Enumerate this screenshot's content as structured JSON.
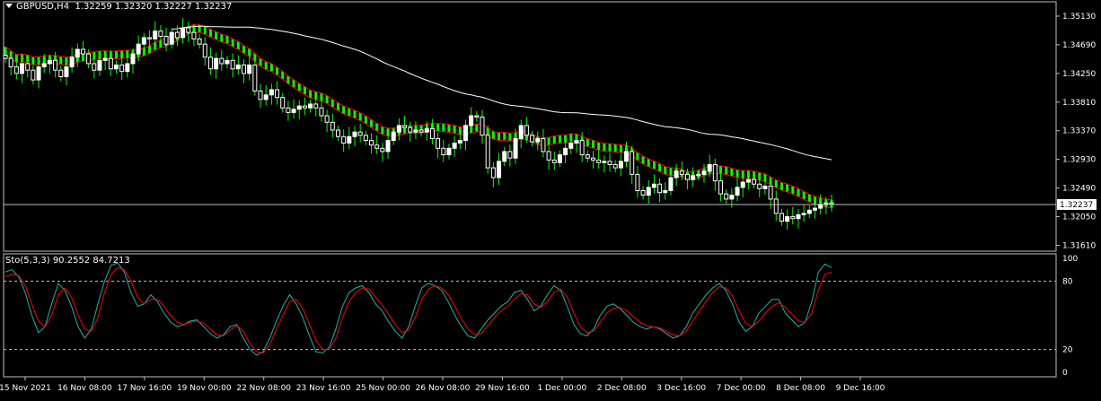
{
  "header": {
    "symbol": "GBPUSD,H4",
    "ohlc": "1.32259 1.32320 1.32227 1.32237"
  },
  "colors": {
    "background": "#000000",
    "frame": "#c0c0c0",
    "text": "#ffffff",
    "candle_bull": "#ffffff",
    "candle_bear": "#ffffff",
    "wick": "#00ff00",
    "band_fill": "#00ff00",
    "band_line": "#ff0000",
    "ma_slow": "#ffffff",
    "stoch_main": "#20b2aa",
    "stoch_signal": "#ff0000",
    "price_line": "#c0c0c0",
    "level_line": "#c0c0c0"
  },
  "chart_data": [
    {
      "type": "candlestick",
      "symbol": "GBPUSD",
      "timeframe": "H4",
      "ylim": [
        1.3152,
        1.3535
      ],
      "y_ticks": [
        "1.35130",
        "1.34690",
        "1.34250",
        "1.33810",
        "1.33370",
        "1.32930",
        "1.32490",
        "1.32050",
        "1.31610"
      ],
      "current_price": "1.32237",
      "x_tick_labels": [
        "15 Nov 2021",
        "16 Nov 08:00",
        "17 Nov 16:00",
        "19 Nov 00:00",
        "22 Nov 08:00",
        "23 Nov 16:00",
        "25 Nov 00:00",
        "26 Nov 08:00",
        "29 Nov 16:00",
        "1 Dec 00:00",
        "2 Dec 08:00",
        "3 Dec 16:00",
        "7 Dec 00:00",
        "8 Dec 08:00",
        "9 Dec 16:00"
      ],
      "candles_close": [
        1.3448,
        1.3435,
        1.3425,
        1.344,
        1.343,
        1.3415,
        1.3435,
        1.344,
        1.3445,
        1.343,
        1.342,
        1.3435,
        1.345,
        1.3462,
        1.3455,
        1.344,
        1.343,
        1.3445,
        1.3448,
        1.3432,
        1.3438,
        1.3428,
        1.344,
        1.3455,
        1.347,
        1.348,
        1.3478,
        1.349,
        1.3482,
        1.347,
        1.3488,
        1.348,
        1.3495,
        1.3488,
        1.3478,
        1.347,
        1.345,
        1.3432,
        1.3448,
        1.344,
        1.3445,
        1.3432,
        1.3438,
        1.3425,
        1.3438,
        1.3398,
        1.3385,
        1.3392,
        1.34,
        1.3388,
        1.3372,
        1.3365,
        1.337,
        1.3375,
        1.3372,
        1.3378,
        1.3372,
        1.336,
        1.335,
        1.3338,
        1.3328,
        1.3318,
        1.3328,
        1.3335,
        1.333,
        1.3322,
        1.3315,
        1.331,
        1.3305,
        1.3322,
        1.3335,
        1.3345,
        1.3342,
        1.3335,
        1.3338,
        1.3335,
        1.334,
        1.3325,
        1.331,
        1.33,
        1.331,
        1.3318,
        1.3322,
        1.3345,
        1.336,
        1.3358,
        1.333,
        1.328,
        1.3265,
        1.329,
        1.3305,
        1.3295,
        1.3325,
        1.3345,
        1.333,
        1.332,
        1.3325,
        1.3305,
        1.3292,
        1.3288,
        1.33,
        1.331,
        1.3318,
        1.3322,
        1.33,
        1.3295,
        1.3292,
        1.3288,
        1.329,
        1.3285,
        1.328,
        1.329,
        1.3305,
        1.327,
        1.3245,
        1.3238,
        1.325,
        1.3255,
        1.3242,
        1.3245,
        1.3265,
        1.3275,
        1.327,
        1.3262,
        1.3268,
        1.327,
        1.3275,
        1.3285,
        1.326,
        1.324,
        1.3232,
        1.3238,
        1.325,
        1.3258,
        1.3262,
        1.3255,
        1.3248,
        1.3252,
        1.3232,
        1.321,
        1.3198,
        1.3205,
        1.3202,
        1.3208,
        1.321,
        1.3215,
        1.3218,
        1.3224,
        1.3226,
        1.3224
      ]
    },
    {
      "type": "line",
      "title": "Sto(5,3,3) 90.2552 84.7213",
      "indicator": "Stochastic Oscillator",
      "params": [
        5,
        3,
        3
      ],
      "main_value": 90.2552,
      "signal_value": 84.7213,
      "ylim": [
        0,
        100
      ],
      "y_ticks": [
        "100",
        "80",
        "20",
        "0"
      ],
      "levels": [
        20,
        80
      ],
      "series": [
        {
          "values": [
            88,
            90,
            84,
            70,
            50,
            35,
            40,
            60,
            78,
            72,
            58,
            40,
            30,
            38,
            60,
            80,
            94,
            96,
            88,
            70,
            58,
            60,
            68,
            62,
            52,
            44,
            40,
            42,
            45,
            46,
            40,
            34,
            30,
            33,
            40,
            42,
            30,
            20,
            15,
            18,
            30,
            45,
            58,
            68,
            60,
            48,
            32,
            18,
            17,
            22,
            38,
            58,
            70,
            74,
            76,
            70,
            60,
            54,
            44,
            36,
            30,
            40,
            58,
            74,
            78,
            76,
            72,
            62,
            50,
            40,
            32,
            30,
            38,
            46,
            52,
            58,
            62,
            70,
            72,
            64,
            54,
            58,
            68,
            76,
            72,
            58,
            42,
            34,
            32,
            38,
            50,
            58,
            60,
            56,
            50,
            44,
            40,
            38,
            40,
            38,
            34,
            30,
            32,
            40,
            52,
            60,
            68,
            74,
            78,
            72,
            60,
            44,
            36,
            40,
            52,
            58,
            64,
            64,
            52,
            46,
            40,
            44,
            62,
            88,
            95,
            92
          ]
        },
        {
          "values": [
            84,
            86,
            85,
            76,
            60,
            45,
            40,
            50,
            68,
            74,
            66,
            50,
            38,
            36,
            48,
            70,
            86,
            92,
            90,
            80,
            66,
            60,
            64,
            64,
            58,
            50,
            44,
            42,
            44,
            45,
            43,
            38,
            33,
            32,
            37,
            41,
            36,
            25,
            18,
            17,
            24,
            38,
            50,
            62,
            64,
            56,
            42,
            28,
            20,
            20,
            30,
            48,
            62,
            70,
            74,
            73,
            66,
            59,
            51,
            42,
            35,
            37,
            48,
            64,
            73,
            76,
            74,
            68,
            58,
            47,
            38,
            33,
            34,
            41,
            48,
            54,
            58,
            64,
            69,
            68,
            60,
            57,
            62,
            70,
            73,
            66,
            52,
            40,
            35,
            36,
            44,
            52,
            56,
            57,
            54,
            49,
            44,
            41,
            40,
            39,
            36,
            33,
            32,
            36,
            45,
            54,
            62,
            70,
            75,
            74,
            67,
            54,
            43,
            40,
            45,
            52,
            58,
            61,
            57,
            51,
            45,
            44,
            52,
            72,
            86,
            88
          ]
        }
      ]
    }
  ]
}
